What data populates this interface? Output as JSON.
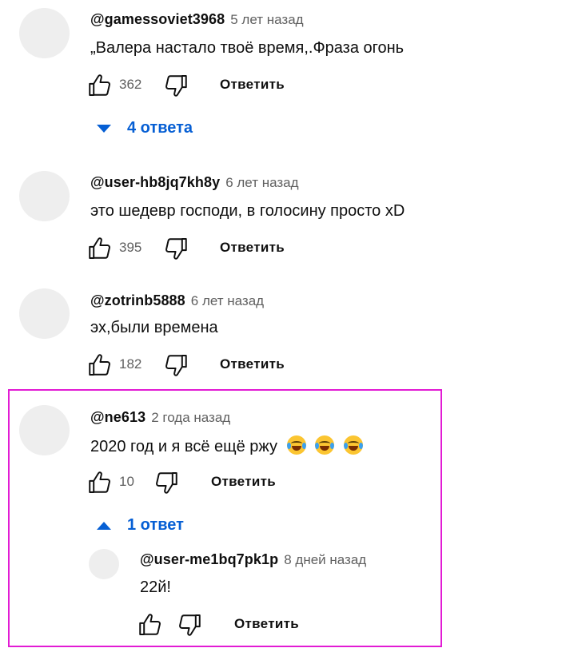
{
  "labels": {
    "reply": "Ответить"
  },
  "comments": [
    {
      "author": "@gamessoviet3968",
      "time": "5 лет назад",
      "text": "„Валера настало твоё время,.Фраза огонь",
      "likes": "362",
      "replies_toggle": "4 ответа"
    },
    {
      "author": "@user-hb8jq7kh8y",
      "time": "6 лет назад",
      "text": "это шедевр господи, в голосину просто xD",
      "likes": "395"
    },
    {
      "author": "@zotrinb5888",
      "time": "6 лет назад",
      "text": "эх,были времена",
      "likes": "182"
    },
    {
      "author": "@ne613",
      "time": "2 года назад",
      "text": "2020 год и я всё ещё ржу",
      "emoji": [
        "face-with-tears-of-joy",
        "face-with-tears-of-joy",
        "face-with-tears-of-joy"
      ],
      "likes": "10",
      "replies_toggle": "1 ответ",
      "replies": [
        {
          "author": "@user-me1bq7pk1p",
          "time": "8 дней назад",
          "text": "22й!",
          "likes": ""
        }
      ]
    }
  ],
  "icons": {
    "like": "thumbs-up-icon",
    "dislike": "thumbs-down-icon",
    "expand": "triangle-down-icon",
    "collapse": "triangle-up-icon"
  },
  "colors": {
    "link": "#065fd4",
    "secondary_text": "#606060",
    "avatar_placeholder": "#eeeeee",
    "highlight_border": "#e21bd4"
  }
}
